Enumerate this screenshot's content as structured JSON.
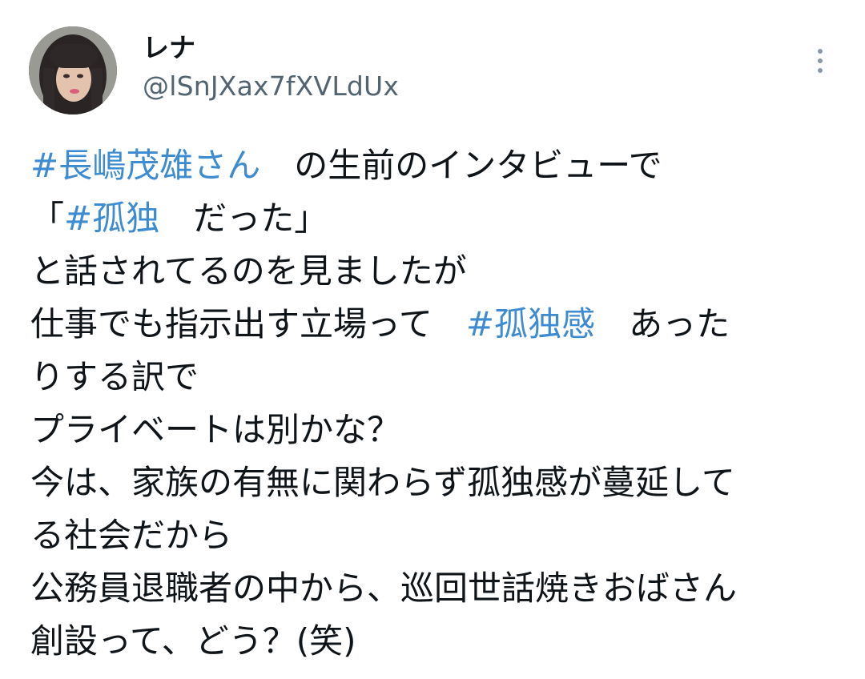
{
  "author": {
    "display_name": "レナ",
    "handle": "@lSnJXax7fXVLdUx",
    "avatar_icon": "user-avatar-photo"
  },
  "more_icon": "more-vertical-icon",
  "colors": {
    "text": "#0f1419",
    "handle": "#536471",
    "hashtag": "#3d8bd0",
    "background": "#ffffff"
  },
  "tweet": {
    "lines": [
      [
        {
          "type": "hashtag",
          "text": "#長嶋茂雄さん"
        },
        {
          "type": "text",
          "text": "　の生前のインタビューで"
        }
      ],
      [
        {
          "type": "text",
          "text": "「"
        },
        {
          "type": "hashtag",
          "text": "#孤独"
        },
        {
          "type": "text",
          "text": "　だった」"
        }
      ],
      [
        {
          "type": "text",
          "text": "と話されてるのを見ましたが"
        }
      ],
      [
        {
          "type": "text",
          "text": "仕事でも指示出す立場って　"
        },
        {
          "type": "hashtag",
          "text": "#孤独感"
        },
        {
          "type": "text",
          "text": "　あった"
        }
      ],
      [
        {
          "type": "text",
          "text": "りする訳で"
        }
      ],
      [
        {
          "type": "text",
          "text": "プライベートは別かな？"
        }
      ],
      [
        {
          "type": "text",
          "text": "今は、家族の有無に関わらず孤独感が蔓延して"
        }
      ],
      [
        {
          "type": "text",
          "text": "る社会だから"
        }
      ],
      [
        {
          "type": "text",
          "text": "公務員退職者の中から、巡回世話焼きおばさん"
        }
      ],
      [
        {
          "type": "text",
          "text": "創設って、どう？(笑)"
        }
      ]
    ]
  }
}
